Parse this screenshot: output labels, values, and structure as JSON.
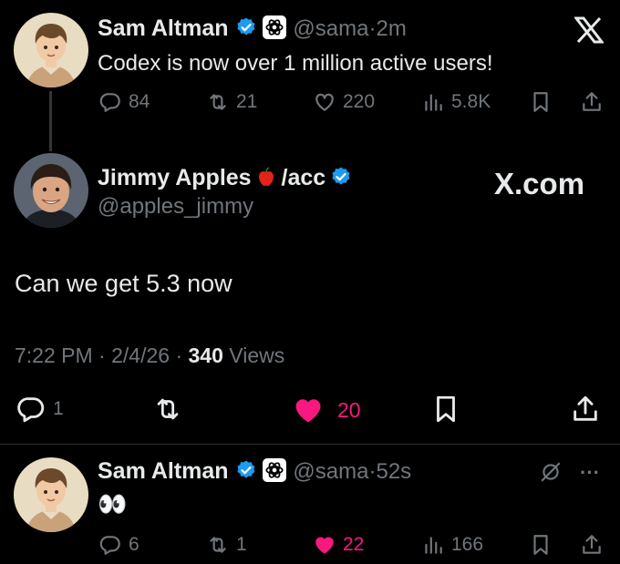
{
  "tweet1": {
    "name": "Sam Altman",
    "handle": "@sama",
    "dot": "·",
    "time": "2m",
    "text": "Codex is now over 1 million active users!",
    "replies": "84",
    "reposts": "21",
    "likes": "220",
    "views": "5.8K"
  },
  "tweet2": {
    "name": "Jimmy Apples",
    "name_suffix": "/acc",
    "handle": "@apples_jimmy",
    "text": "Can we get 5.3 now",
    "time": "7:22 PM",
    "date": "2/4/26",
    "dot": "·",
    "views_count": "340",
    "views_label": "Views",
    "replies": "1",
    "likes": "20",
    "watermark": "X.com"
  },
  "tweet3": {
    "name": "Sam Altman",
    "handle": "@sama",
    "dot": "·",
    "time": "52s",
    "text": "👀",
    "replies": "6",
    "reposts": "1",
    "likes": "22",
    "views": "166",
    "more": "···"
  },
  "colors": {
    "background": "#000000",
    "text": "#e7e9ea",
    "muted": "#71767b",
    "verified": "#1d9bf0",
    "like": "#f91880"
  },
  "icons": [
    "x-logo",
    "verified-badge",
    "openai-badge",
    "reply-icon",
    "repost-icon",
    "like-icon",
    "views-icon",
    "bookmark-icon",
    "share-icon",
    "grok-icon",
    "more-icon",
    "apple-emoji"
  ]
}
